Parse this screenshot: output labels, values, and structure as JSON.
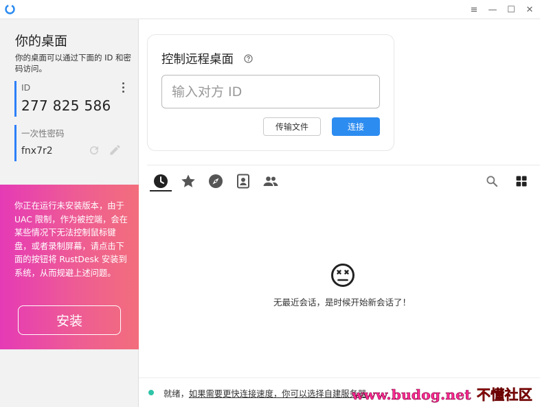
{
  "window": {
    "controls": {
      "menu": "≡",
      "minimize": "—",
      "maximize": "☐",
      "close": "✕"
    }
  },
  "sidebar": {
    "title": "你的桌面",
    "description": "你的桌面可以通过下面的 ID 和密码访问。",
    "id_label": "ID",
    "id_value": "277 825 586",
    "password_label": "一次性密码",
    "password_value": "fnx7r2",
    "install_message": "你正在运行未安装版本，由于 UAC 限制，作为被控端，会在某些情况下无法控制鼠标键盘，或者录制屏幕，请点击下面的按钮将 RustDesk 安装到系统，从而规避上述问题。",
    "install_button": "安装"
  },
  "connect": {
    "title": "控制远程桌面",
    "input_placeholder": "输入对方 ID",
    "transfer_button": "传输文件",
    "connect_button": "连接"
  },
  "tabs": [
    {
      "name": "recent-sessions",
      "icon": "clock-icon",
      "active": true
    },
    {
      "name": "favorites",
      "icon": "star-icon",
      "active": false
    },
    {
      "name": "discovered",
      "icon": "compass-icon",
      "active": false
    },
    {
      "name": "address-book",
      "icon": "contacts-icon",
      "active": false
    },
    {
      "name": "group",
      "icon": "people-icon",
      "active": false
    }
  ],
  "sessions": {
    "empty_message": "无最近会话，是时候开始新会话了！"
  },
  "status": {
    "ready": "就绪，",
    "hint_link": "如果需要更快连接速度，你可以选择自建服务器"
  },
  "watermark": {
    "site": "www.budog.net",
    "name": "不懂社区"
  },
  "colors": {
    "accent": "#2d8cf0",
    "id_bar": "#2d7ff9",
    "install_gradient_start": "#e53ab6",
    "install_gradient_end": "#f26e7c",
    "status_ok": "#2fc4a8"
  }
}
